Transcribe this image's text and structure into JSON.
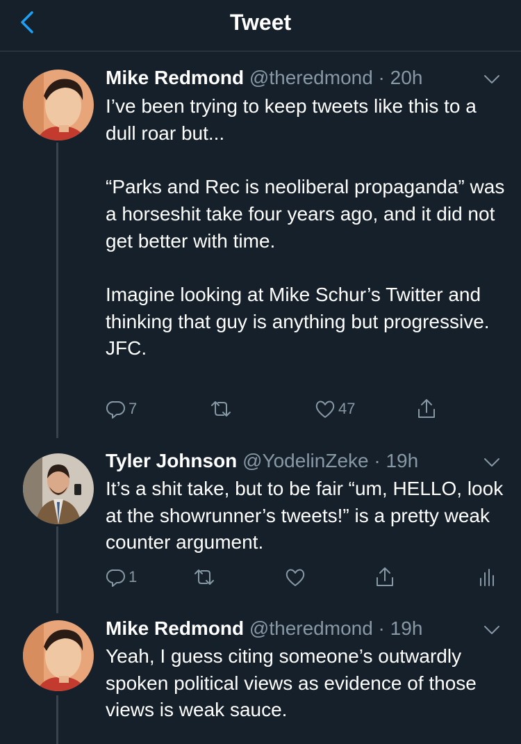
{
  "header": {
    "title": "Tweet"
  },
  "tweets": [
    {
      "name": "Mike Redmond",
      "handle": "@theredmond",
      "time": "20h",
      "paragraphs": [
        "I’ve been trying to keep tweets like this to a dull roar but...",
        "“Parks and Rec is neoliberal propaganda” was a horseshit take four years ago, and it did not get better with time.",
        "Imagine looking at Mike Schur’s Twitter and thinking that guy is anything but progressive. JFC."
      ],
      "reply_count": "7",
      "retweet_count": "",
      "like_count": "47"
    },
    {
      "name": "Tyler Johnson",
      "handle": "@YodelinZeke",
      "time": "19h",
      "paragraphs": [
        "It’s a shit take, but to be fair “um, HELLO, look at the showrunner’s tweets!” is a pretty weak counter argument."
      ],
      "reply_count": "1",
      "retweet_count": "",
      "like_count": ""
    },
    {
      "name": "Mike Redmond",
      "handle": "@theredmond",
      "time": "19h",
      "paragraphs": [
        "Yeah, I guess citing someone’s outwardly spoken political views  as evidence of those views is weak sauce."
      ]
    }
  ],
  "colors": {
    "background": "#15202b",
    "accent": "#1da1f2",
    "secondary_text": "#8899a6",
    "divider": "#38444d"
  },
  "icons": [
    "back-chevron-icon",
    "caret-down-icon",
    "reply-icon",
    "retweet-icon",
    "like-icon",
    "share-icon",
    "analytics-icon"
  ]
}
